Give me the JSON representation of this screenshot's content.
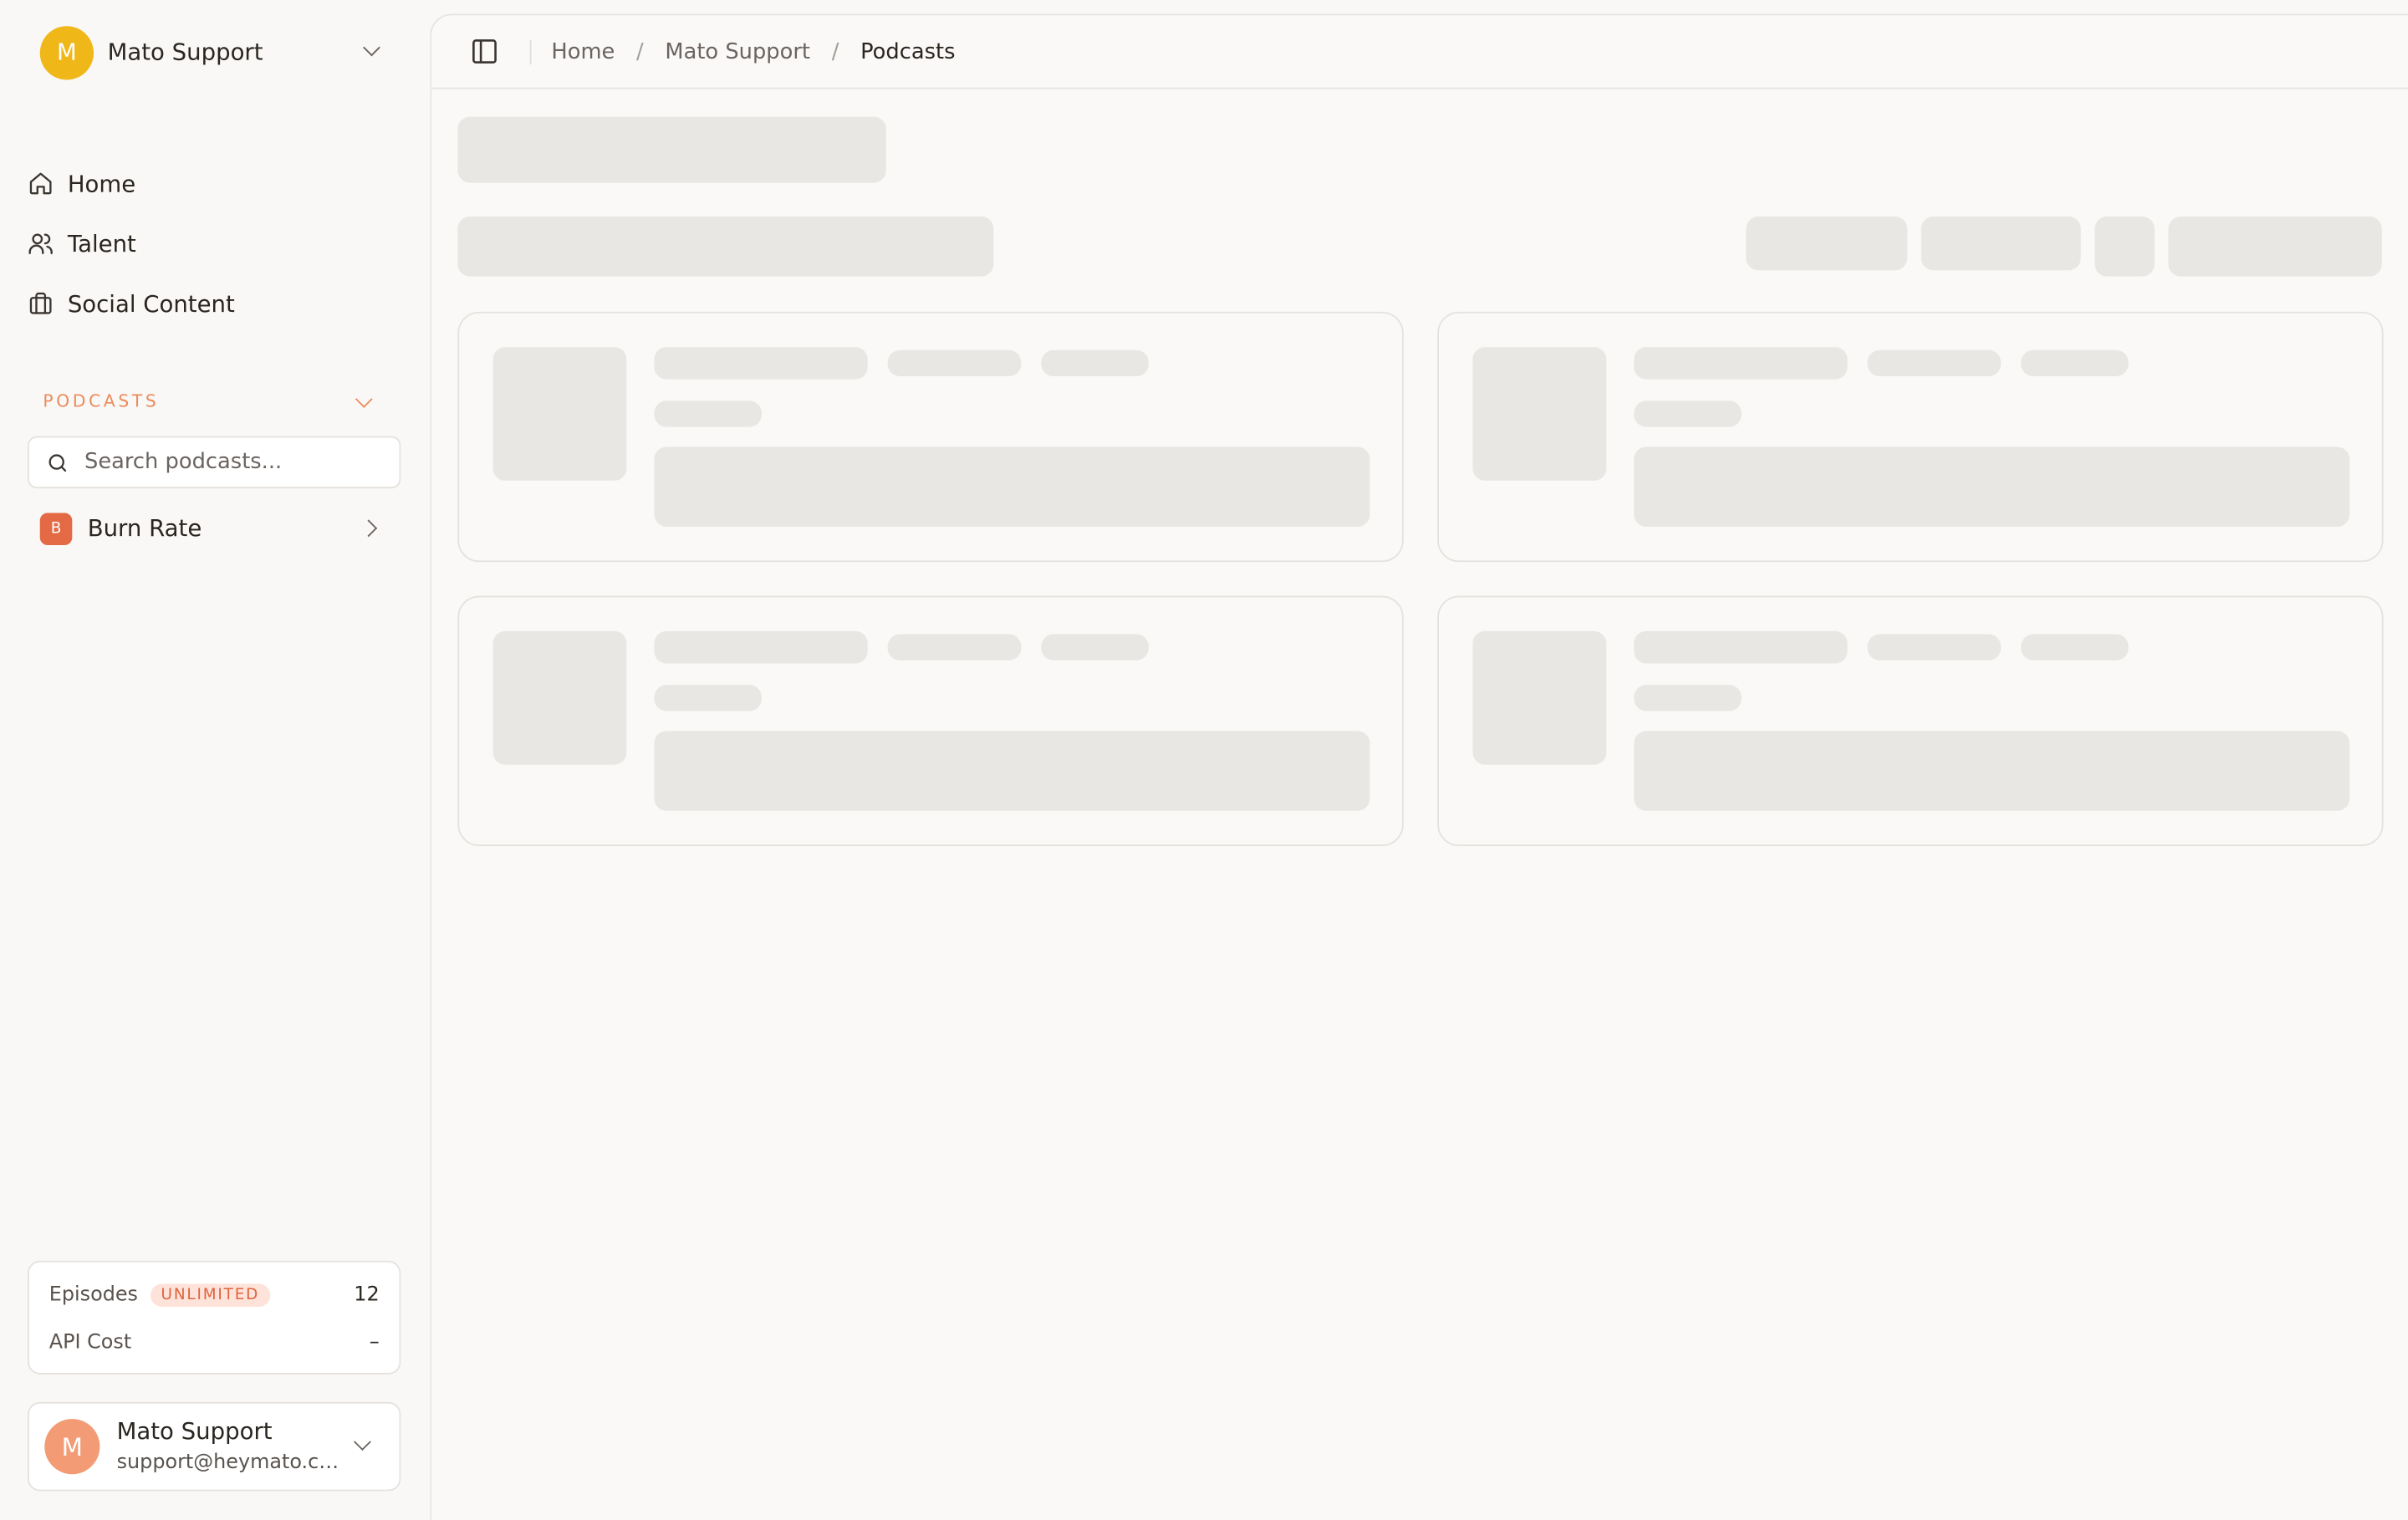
{
  "org": {
    "initial": "M",
    "name": "Mato Support"
  },
  "nav": {
    "items": [
      {
        "label": "Home",
        "icon": "home-icon"
      },
      {
        "label": "Talent",
        "icon": "users-icon"
      },
      {
        "label": "Social Content",
        "icon": "briefcase-icon"
      }
    ]
  },
  "podcasts": {
    "section_title": "PODCASTS",
    "search_placeholder": "Search podcasts...",
    "items": [
      {
        "badge": "B",
        "name": "Burn Rate"
      }
    ]
  },
  "usage": {
    "episodes_label": "Episodes",
    "episodes_badge": "UNLIMITED",
    "episodes_value": "12",
    "api_cost_label": "API Cost",
    "api_cost_value": "–"
  },
  "user": {
    "initial": "M",
    "name": "Mato Support",
    "email": "support@heymato.com"
  },
  "breadcrumb": {
    "items": [
      "Home",
      "Mato Support",
      "Podcasts"
    ],
    "separator": "/"
  },
  "colors": {
    "accent": "#ec8a5b",
    "org_avatar": "#f0b718",
    "podcast_badge": "#e36a45",
    "user_avatar": "#f39b74",
    "skeleton": "#e9e7e4",
    "background": "#f9f8f6"
  }
}
